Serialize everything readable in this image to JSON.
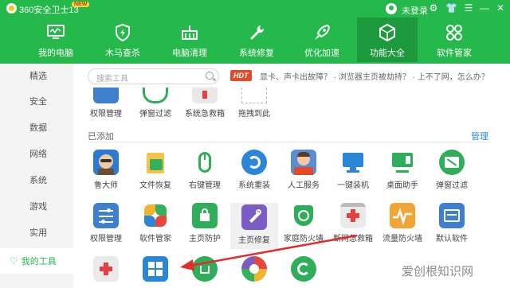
{
  "titlebar": {
    "app_title": "360安全卫士13",
    "badge": "NEW",
    "login": "未登录"
  },
  "nav": [
    {
      "label": "我的电脑",
      "icon": "monitor-icon"
    },
    {
      "label": "木马查杀",
      "icon": "shield-icon"
    },
    {
      "label": "电脑清理",
      "icon": "broom-icon"
    },
    {
      "label": "系统修复",
      "icon": "wrench-icon"
    },
    {
      "label": "优化加速",
      "icon": "rocket-icon"
    },
    {
      "label": "功能大全",
      "icon": "cube-icon",
      "active": true
    },
    {
      "label": "软件管家",
      "icon": "flower-icon"
    }
  ],
  "sidebar": [
    {
      "label": "精选"
    },
    {
      "label": "安全"
    },
    {
      "label": "数据"
    },
    {
      "label": "网络"
    },
    {
      "label": "系统"
    },
    {
      "label": "游戏"
    },
    {
      "label": "实用"
    },
    {
      "label": "我的工具",
      "active": true
    }
  ],
  "search": {
    "placeholder": "搜索工具"
  },
  "tips": {
    "badge": "HDT",
    "text": "显卡、声卡出故障？ · 浏览器主页被劫持？ · 上不了网，怎么办？"
  },
  "top_row": [
    {
      "label": "权限管理"
    },
    {
      "label": "弹窗过滤"
    },
    {
      "label": "系统急救箱"
    },
    {
      "label": "拖拽到此"
    }
  ],
  "section": {
    "title": "已添加",
    "manage": "管理"
  },
  "row1": [
    {
      "label": "鲁大师",
      "icon": "ludashi-icon"
    },
    {
      "label": "文件恢复",
      "icon": "file-restore-icon"
    },
    {
      "label": "右键管理",
      "icon": "mouse-icon"
    },
    {
      "label": "系统重装",
      "icon": "reinstall-icon"
    },
    {
      "label": "人工服务",
      "icon": "service-icon"
    },
    {
      "label": "一键装机",
      "icon": "computer-icon"
    },
    {
      "label": "桌面助手",
      "icon": "desktop-icon"
    },
    {
      "label": "弹窗过滤",
      "icon": "popup-filter-icon"
    }
  ],
  "row2": [
    {
      "label": "权限管理",
      "icon": "permission-icon"
    },
    {
      "label": "软件管家",
      "icon": "software-icon"
    },
    {
      "label": "主页防护",
      "icon": "homepage-lock-icon"
    },
    {
      "label": "主页修复",
      "icon": "homepage-fix-icon"
    },
    {
      "label": "家庭防火墙",
      "icon": "family-firewall-icon"
    },
    {
      "label": "断网急救箱",
      "icon": "network-aid-icon"
    },
    {
      "label": "流量防火墙",
      "icon": "traffic-firewall-icon"
    },
    {
      "label": "默认软件",
      "icon": "default-software-icon"
    }
  ],
  "watermark": "爱创根知识网"
}
